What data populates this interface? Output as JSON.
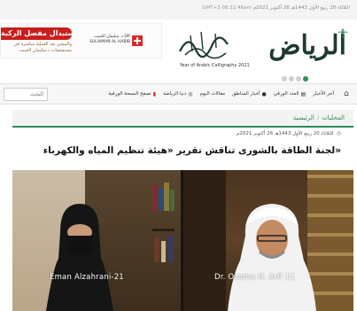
{
  "topbar": {
    "date": "الثلاثاء 20 ربيع الأول 1443هـ 26 أكتوبر 2021م",
    "gmt": "GMT+3 08:22:46am"
  },
  "ad": {
    "cta": "عمليات استبدال مفصل الركبة",
    "description": "والمشي بعد العملية مباشرة في مستشفيات د.سليمان الحبيب",
    "brand": "د. سليمان الحبيب DR SULAIMAN AL HABIB"
  },
  "masthead": {
    "logo_text": "الرياض",
    "calligraphy_caption": "Year of Arabic Calligraphy 2021"
  },
  "slider": {
    "dots": 4,
    "active_index": 0
  },
  "nav": {
    "search_placeholder": "البحث",
    "items": [
      {
        "label": "آخر الأخبار",
        "icon": "none",
        "accent": false
      },
      {
        "label": "العدد الورقي",
        "icon": "newspaper-icon",
        "accent": false
      },
      {
        "label": "أخبار المناطق",
        "icon": "location-pin-icon",
        "accent": false
      },
      {
        "label": "مقالات اليوم",
        "icon": "none",
        "accent": false
      },
      {
        "label": "دنيا الرياضة",
        "icon": "sports-ball-icon",
        "accent": false
      },
      {
        "label": "تصفح النسخة الورقية",
        "icon": "pdf-icon",
        "accent": false
      }
    ]
  },
  "breadcrumb": {
    "home": "الرئيسية",
    "current": "المحليات"
  },
  "article": {
    "date": "الثلاثاء 20 ربيع الأول 1443هـ 26 أكتوبر 2021م",
    "headline": "لجنة الطاقة بالشورى تناقش تقرير «هيئة تنظيم المياه والكهرباء»"
  },
  "video": {
    "left_name": "Eman Alzahrani-21",
    "right_name": "Dr. Osama H. Arif 11"
  },
  "colors": {
    "brand_green": "#2c8e56",
    "accent_red": "#c81e1e",
    "logo_dark": "#1d3a2f"
  }
}
